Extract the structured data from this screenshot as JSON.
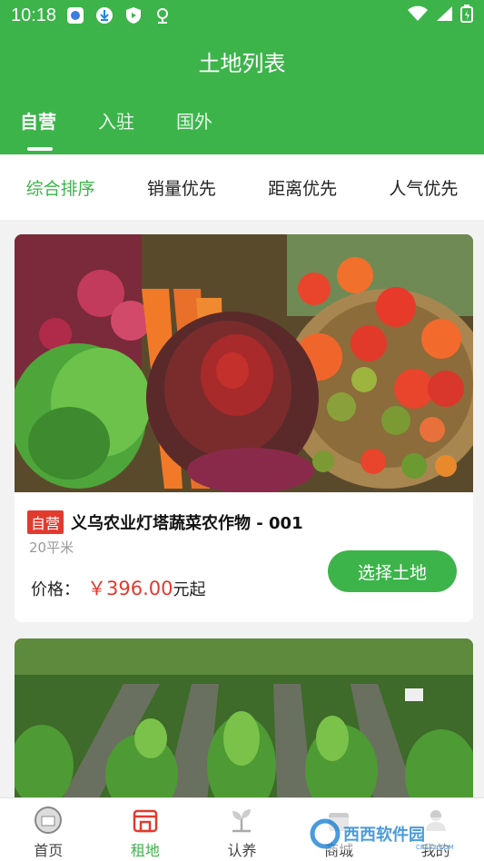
{
  "status_bar": {
    "time": "10:18"
  },
  "header": {
    "title": "土地列表"
  },
  "tabs": [
    {
      "label": "自营",
      "active": true
    },
    {
      "label": "入驻",
      "active": false
    },
    {
      "label": "国外",
      "active": false
    }
  ],
  "sort_options": [
    {
      "label": "综合排序",
      "active": true
    },
    {
      "label": "销量优先",
      "active": false
    },
    {
      "label": "距离优先",
      "active": false
    },
    {
      "label": "人气优先",
      "active": false
    }
  ],
  "listings": [
    {
      "badge": "自营",
      "name": "义乌农业灯塔蔬菜农作物 - 001",
      "area": "20平米",
      "price_label": "价格：",
      "price": "￥396.00",
      "price_suffix": "元起",
      "button": "选择土地"
    }
  ],
  "bottom_nav": [
    {
      "label": "首页",
      "icon": "home-icon",
      "active": false
    },
    {
      "label": "租地",
      "icon": "shop-icon",
      "active": true
    },
    {
      "label": "认养",
      "icon": "plant-icon",
      "active": false
    },
    {
      "label": "商城",
      "icon": "mall-icon",
      "active": false
    },
    {
      "label": "我的",
      "icon": "user-icon",
      "active": false
    }
  ],
  "watermark": {
    "text": "西西软件园",
    "sub": "CR173.COM"
  },
  "colors": {
    "primary": "#3cb44a",
    "price": "#e23a2e"
  }
}
